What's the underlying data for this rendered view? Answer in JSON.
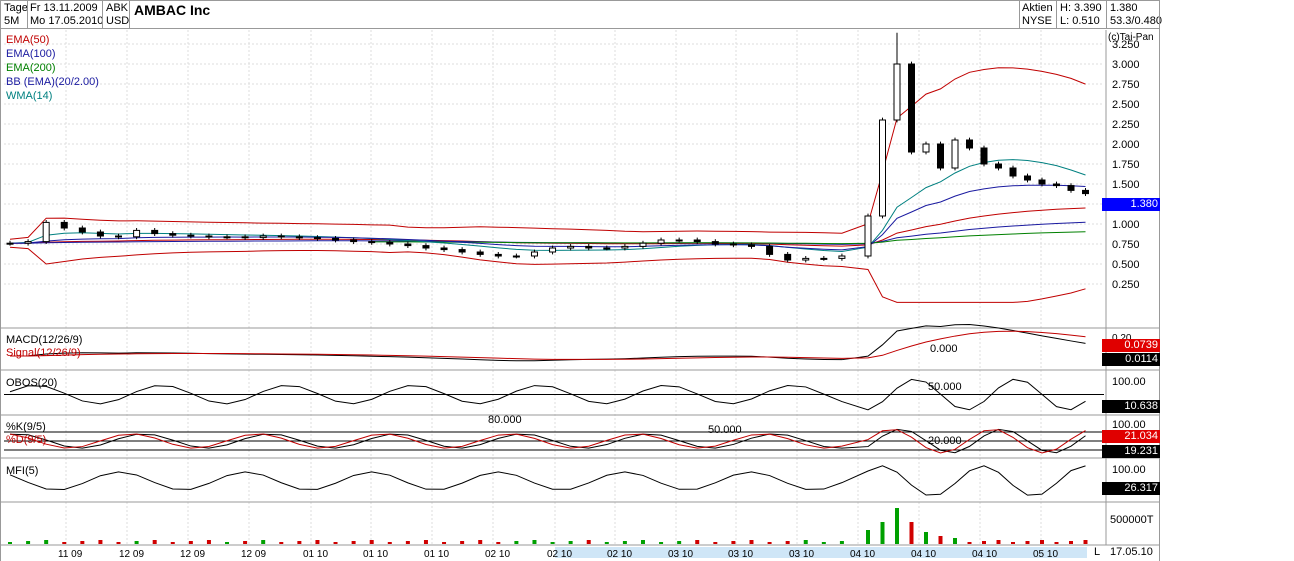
{
  "header": {
    "period": "Tage",
    "interval": "5M",
    "date_from": "Fr 13.11.2009",
    "date_to": "Mo 17.05.2010",
    "ticker": "ABK",
    "currency": "USD",
    "title": "AMBAC Inc",
    "type": "Aktien",
    "exchange": "NYSE",
    "high": "H: 3.390",
    "low": "L: 0.510",
    "last": "1.380",
    "range": "53.3/0.480",
    "copyright": "(c)Tai-Pan"
  },
  "legend": [
    {
      "label": "EMA(50)",
      "color": "#c00000"
    },
    {
      "label": "EMA(100)",
      "color": "#1a1aa0"
    },
    {
      "label": "EMA(200)",
      "color": "#008000"
    },
    {
      "label": "BB (EMA)(20/2.00)",
      "color": "#1a1aa0"
    },
    {
      "label": "WMA(14)",
      "color": "#008080"
    }
  ],
  "price_axis": [
    "3.250",
    "3.000",
    "2.750",
    "2.500",
    "2.250",
    "2.000",
    "1.750",
    "1.500",
    "1.250",
    "1.000",
    "0.750",
    "0.500",
    "0.250"
  ],
  "price_marker": "1.380",
  "macd": {
    "label1": "MACD(12/26/9)",
    "label2": "Signal(12/26/9)",
    "zero": "0.000",
    "axis_top": "0.20",
    "value1": "0.0739",
    "value2": "0.0114"
  },
  "obos": {
    "label": "OBOS(20)",
    "mid": "50.000",
    "axis_top": "100.00",
    "value": "10.638"
  },
  "stoch": {
    "label1": "%K(9/5)",
    "label2": "%D(9/5)",
    "upper": "80.000",
    "mid": "50.000",
    "lower": "20.000",
    "axis_top": "100.00",
    "value1": "21.034",
    "value2": "19.231"
  },
  "mfi": {
    "label": "MFI(5)",
    "axis_top": "100.00",
    "value": "26.317"
  },
  "volume": {
    "axis": "500000T"
  },
  "date_axis": [
    "11 09",
    "12 09",
    "12 09",
    "12 09",
    "01 10",
    "01 10",
    "01 10",
    "02 10",
    "02 10",
    "02 10",
    "03 10",
    "03 10",
    "03 10",
    "04 10",
    "04 10",
    "04 10",
    "05 10"
  ],
  "date_end": "17.05.10",
  "scroll_mark": "L",
  "colors": {
    "up": "#ffffff",
    "down": "#000000",
    "ema50": "#c00000",
    "ema100": "#1a1aa0",
    "ema200": "#008000",
    "bb": "#c00000",
    "wma": "#008080",
    "vol_up": "#00a000",
    "vol_down": "#d00000",
    "marker": "#0000ff"
  },
  "chart_data": {
    "type": "line",
    "title": "AMBAC Inc",
    "ylim": [
      0,
      3.25
    ],
    "series": [
      {
        "name": "close",
        "values": [
          0.76,
          0.78,
          1.02,
          0.95,
          0.9,
          0.85,
          0.84,
          0.92,
          0.88,
          0.86,
          0.85,
          0.84,
          0.84,
          0.83,
          0.85,
          0.84,
          0.83,
          0.82,
          0.8,
          0.78,
          0.77,
          0.75,
          0.73,
          0.7,
          0.68,
          0.65,
          0.62,
          0.6,
          0.6,
          0.65,
          0.7,
          0.72,
          0.7,
          0.7,
          0.72,
          0.76,
          0.8,
          0.8,
          0.78,
          0.75,
          0.74,
          0.72,
          0.62,
          0.55,
          0.57,
          0.57,
          0.6,
          1.1,
          2.3,
          3.0,
          1.9,
          2.0,
          1.7,
          2.05,
          1.95,
          1.75,
          1.7,
          1.6,
          1.55,
          1.5,
          1.48,
          1.42,
          1.38
        ]
      }
    ]
  }
}
